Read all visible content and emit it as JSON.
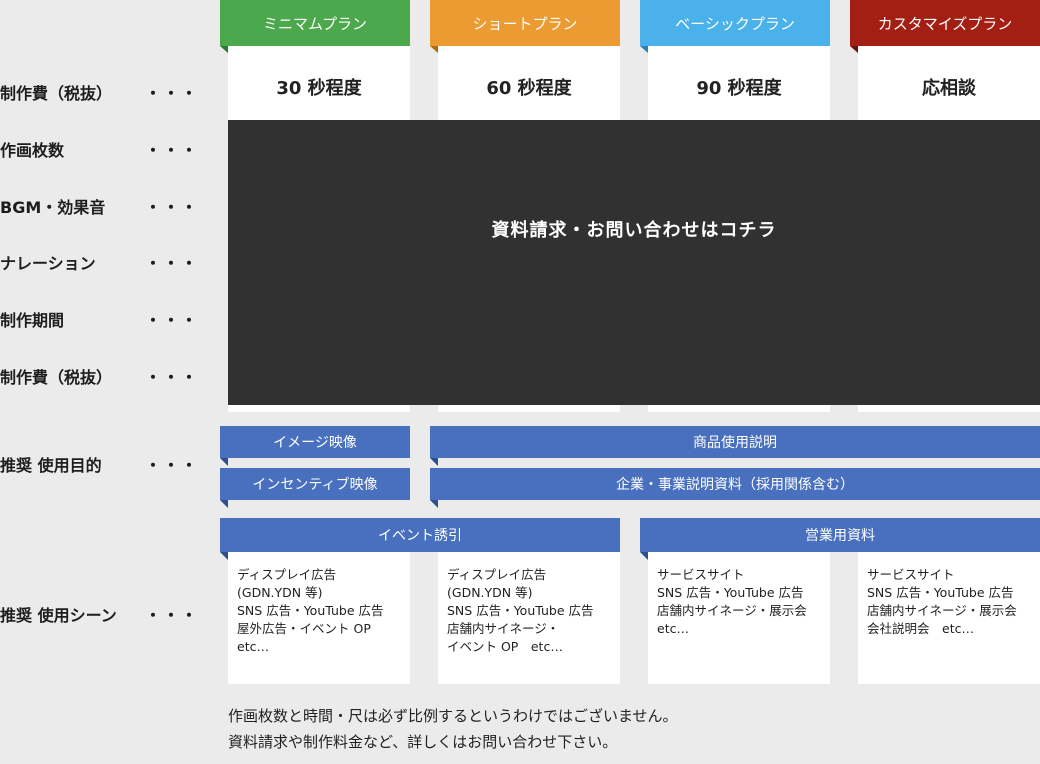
{
  "plans": [
    {
      "name": "ミニマムプラン",
      "color": "#4ca84d",
      "fold": "#2f7a31",
      "price": "30 秒程度"
    },
    {
      "name": "ショートプラン",
      "color": "#ec9b32",
      "fold": "#b06a15",
      "price": "60 秒程度"
    },
    {
      "name": "ベーシックプラン",
      "color": "#4bb1ea",
      "fold": "#2e7fae",
      "price": "90 秒程度"
    },
    {
      "name": "カスタマイズプラン",
      "color": "#a31f14",
      "fold": "#6b120b",
      "price": "応相談"
    }
  ],
  "rows": [
    {
      "label": "制作費（税抜）",
      "dots": "・・・"
    },
    {
      "label": "作画枚数",
      "dots": "・・・"
    },
    {
      "label": "BGM・効果音",
      "dots": "・・・"
    },
    {
      "label": "ナレーション",
      "dots": "・・・"
    },
    {
      "label": "制作期間",
      "dots": "・・・"
    },
    {
      "label": "制作費（税抜）",
      "dots": "・・・"
    },
    {
      "label": "推奨 使用目的",
      "dots": "・・・"
    },
    {
      "label": "推奨 使用シーン",
      "dots": "・・・"
    }
  ],
  "overlay_text": "資料請求・お問い合わせはコチラ",
  "purposes": {
    "image_video": "イメージ映像",
    "product_usage": "商品使用説明",
    "incentive_video": "インセンティブ映像",
    "corporate_docs": "企業・事業説明資料（採用関係含む）",
    "event": "イベント誘引",
    "sales_docs": "営業用資料"
  },
  "scenes": [
    [
      "ディスプレイ広告",
      "(GDN.YDN 等)",
      "SNS 広告・YouTube 広告",
      "屋外広告・イベント OP",
      "etc…"
    ],
    [
      "ディスプレイ広告",
      "(GDN.YDN 等)",
      "SNS 広告・YouTube 広告",
      "店舗内サイネージ・",
      "イベント OP　etc…"
    ],
    [
      "サービスサイト",
      "SNS 広告・YouTube 広告",
      "店舗内サイネージ・展示会",
      "etc…"
    ],
    [
      "サービスサイト",
      "SNS 広告・YouTube 広告",
      "店舗内サイネージ・展示会",
      "会社説明会　etc…"
    ]
  ],
  "notes": [
    "作画枚数と時間・尺は必ず比例するというわけではございません。",
    "資料請求や制作料金など、詳しくはお問い合わせ下さい。"
  ],
  "bar_color": "#4870be",
  "overlay_color": "#313131"
}
